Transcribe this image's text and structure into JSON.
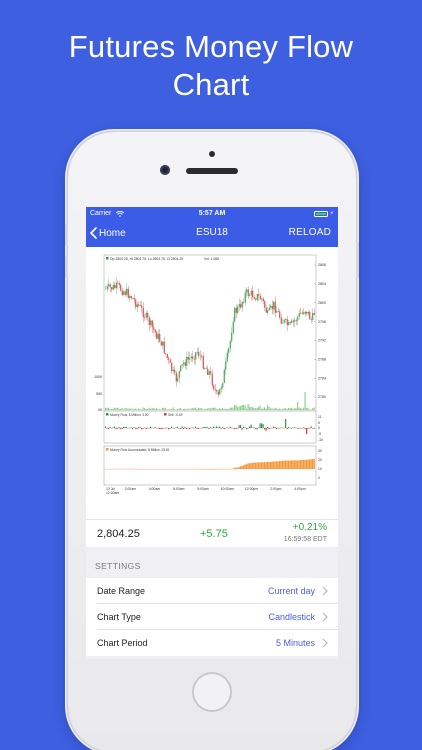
{
  "headline": {
    "line1": "Futures Money Flow",
    "line2": "Chart"
  },
  "status_bar": {
    "carrier": "Carrier",
    "time": "5:57 AM"
  },
  "nav": {
    "back_label": "Home",
    "title": "ESU18",
    "reload_label": "RELOAD"
  },
  "chart_panel": {
    "price_info": "Op 2804.25, Hi 2804.75, Lo 2803.75, Cl 2804.25",
    "vol_info": "Vol: 1,086",
    "price_ticks": [
      "2808",
      "2804",
      "2800",
      "2796",
      "2792",
      "2788",
      "2784",
      "2780"
    ],
    "volume_ticks": [
      "100K",
      "50K",
      "0K"
    ],
    "money_flow_legend_buy": "Money Flow, $ Million: 3.00",
    "money_flow_legend_sell": "Sell: -0.49",
    "money_flow_ticks": [
      "11",
      "5",
      "0",
      "-5",
      "-10"
    ],
    "accum_legend": "Money Flow Accumulated, $ Million: 25.81",
    "accum_ticks": [
      "30",
      "20",
      "10",
      "0"
    ],
    "time_ticks": [
      "13 Jul\n12:00am",
      "2:00am",
      "4:00am",
      "6:00am",
      "8:00am",
      "10:00am",
      "12:00pm",
      "2:00pm",
      "4:00pm"
    ],
    "colors": {
      "up": "#2e9e44",
      "down": "#d23b3b",
      "accum": "#f29a3a",
      "volume": "#8ed08e"
    }
  },
  "quote": {
    "last": "2,804.25",
    "change": "+5.75",
    "change_pct": "+0.21%",
    "timestamp": "16:59:58 EDT"
  },
  "settings": {
    "header": "SETTINGS",
    "rows": [
      {
        "label": "Date Range",
        "value": "Current day"
      },
      {
        "label": "Chart Type",
        "value": "Candlestick"
      },
      {
        "label": "Chart Period",
        "value": "5 Minutes"
      }
    ]
  }
}
